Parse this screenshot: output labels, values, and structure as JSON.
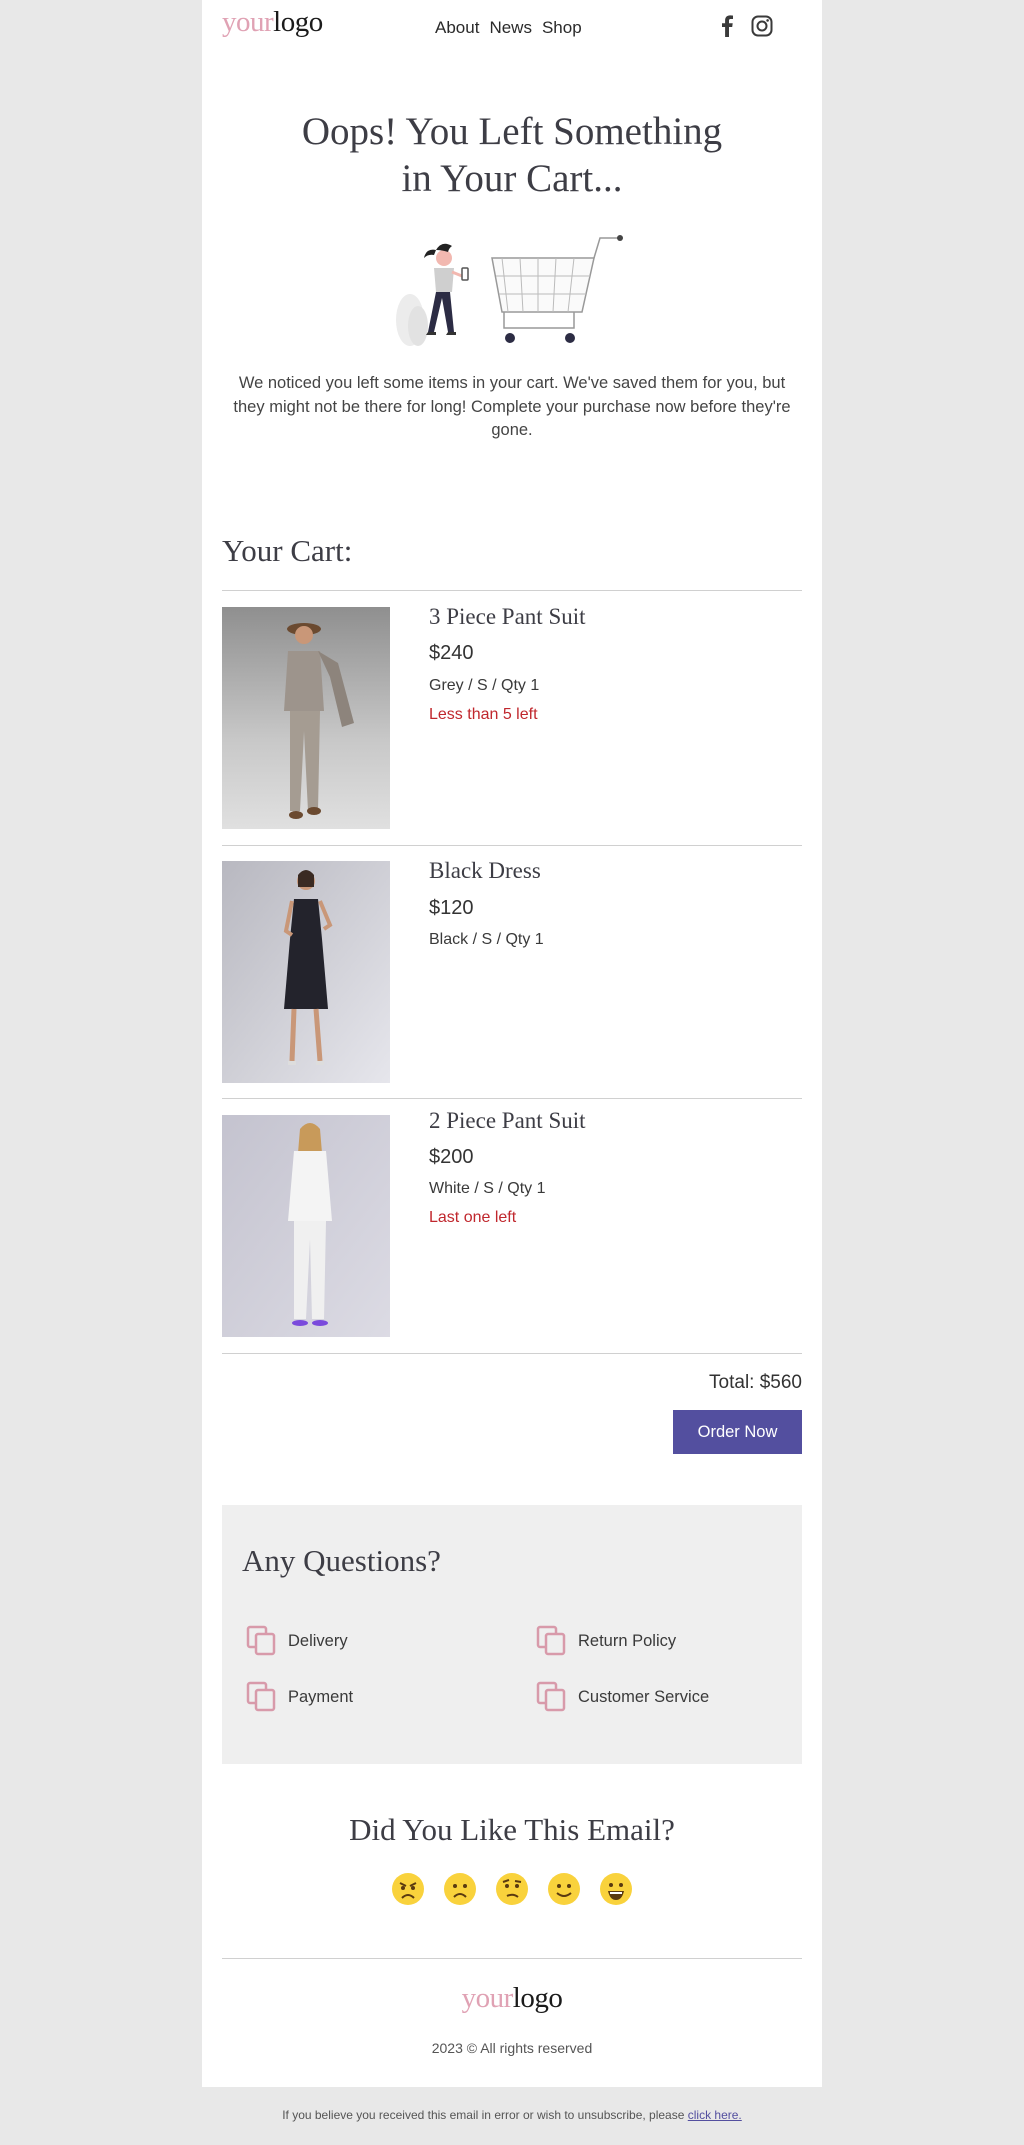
{
  "header": {
    "logo_part1": "your",
    "logo_part2": "logo",
    "nav": [
      "About",
      "News",
      "Shop"
    ],
    "social": [
      "facebook-icon",
      "instagram-icon"
    ]
  },
  "hero": {
    "title_line1": "Oops! You Left Something",
    "title_line2": "in Your Cart...",
    "intro": "We noticed you left some items in your cart. We've saved them for you, but they might not be there for long! Complete your purchase now before they're gone."
  },
  "cart": {
    "title": "Your Cart:",
    "items": [
      {
        "name": "3 Piece Pant Suit",
        "price": "$240",
        "meta": "Grey / S / Qty 1",
        "stock": "Less than 5 left"
      },
      {
        "name": "Black Dress",
        "price": "$120",
        "meta": "Black / S / Qty 1",
        "stock": ""
      },
      {
        "name": "2 Piece Pant Suit",
        "price": "$200",
        "meta": "White / S / Qty 1",
        "stock": "Last one left"
      }
    ],
    "total": "Total: $560",
    "order_button": "Order Now"
  },
  "faq": {
    "title": "Any Questions?",
    "items": [
      "Delivery",
      "Return Policy",
      "Payment",
      "Customer Service"
    ]
  },
  "rating": {
    "title": "Did You Like This Email?",
    "emojis": [
      "angry-face-icon",
      "frowning-face-icon",
      "skeptical-face-icon",
      "slightly-smiling-face-icon",
      "grinning-face-icon"
    ]
  },
  "footer": {
    "logo_part1": "your",
    "logo_part2": "logo",
    "copyright": "2023 © All rights reserved",
    "unsubscribe_text": "If you believe you received this email in error or wish to unsubscribe, please ",
    "unsubscribe_link": "click here."
  },
  "colors": {
    "accent": "#534f9f",
    "logo_pink": "#e0a2b4",
    "stock_red": "#c0272d",
    "faq_bg": "#efefef",
    "page_bg": "#e8e8e8"
  }
}
